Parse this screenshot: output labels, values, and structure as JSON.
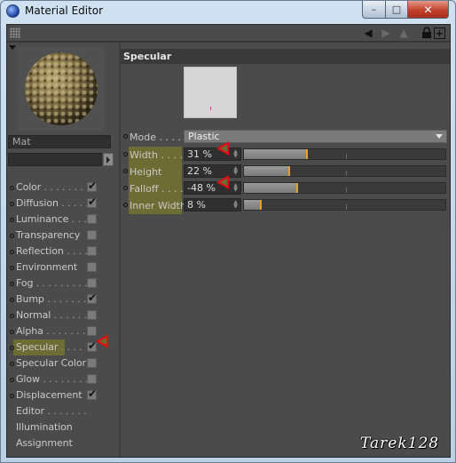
{
  "window": {
    "title": "Material Editor",
    "buttons": {
      "minimize": "–",
      "maximize": "□",
      "close": "✕"
    }
  },
  "toolbar": {
    "icons": [
      "grip-icon",
      "arrow-left-icon",
      "arrow-right-icon",
      "arrow-up-icon",
      "lock-icon",
      "new-icon"
    ],
    "glyphs": {
      "left": "◀",
      "right": "▶",
      "up": "▲",
      "lock": "🔒",
      "new": "+"
    }
  },
  "material": {
    "name": "Mat",
    "channels": [
      {
        "label": "Color",
        "dots": " . . . . . . . .",
        "checked": true,
        "has_checkbox": true
      },
      {
        "label": "Diffusion",
        "dots": " . . . . .",
        "checked": true,
        "has_checkbox": true
      },
      {
        "label": "Luminance",
        "dots": " . . .",
        "checked": false,
        "has_checkbox": true
      },
      {
        "label": "Transparency",
        "dots": "",
        "checked": false,
        "has_checkbox": true
      },
      {
        "label": "Reflection",
        "dots": " . . . .",
        "checked": false,
        "has_checkbox": true
      },
      {
        "label": "Environment",
        "dots": "",
        "checked": false,
        "has_checkbox": true
      },
      {
        "label": "Fog",
        "dots": " . . . . . . . . .",
        "checked": false,
        "has_checkbox": true
      },
      {
        "label": "Bump",
        "dots": " . . . . . . . .",
        "checked": true,
        "has_checkbox": true
      },
      {
        "label": "Normal",
        "dots": " . . . . . . .",
        "checked": false,
        "has_checkbox": true
      },
      {
        "label": "Alpha",
        "dots": " . . . . . . . .",
        "checked": false,
        "has_checkbox": true
      },
      {
        "label": "Specular",
        "dots": " . . . .",
        "checked": true,
        "has_checkbox": true,
        "active": true
      },
      {
        "label": "Specular Color",
        "dots": "",
        "checked": false,
        "has_checkbox": true
      },
      {
        "label": "Glow",
        "dots": " . . . . . . . . .",
        "checked": false,
        "has_checkbox": true
      },
      {
        "label": "Displacement",
        "dots": "",
        "checked": true,
        "has_checkbox": true
      },
      {
        "label": "Editor",
        "dots": " . . . . . . .",
        "checked": false,
        "has_checkbox": false
      },
      {
        "label": "Illumination",
        "dots": "",
        "checked": false,
        "has_checkbox": false
      },
      {
        "label": "Assignment",
        "dots": "",
        "checked": false,
        "has_checkbox": false
      }
    ]
  },
  "specular": {
    "section_title": "Specular",
    "mode": {
      "label": "Mode",
      "dots": " . . . .",
      "value": "Plastic"
    },
    "params": [
      {
        "label": "Width",
        "dots": " . . . .",
        "value": "31 %",
        "fraction": 0.31,
        "highlight": true,
        "arrow": true
      },
      {
        "label": "Height",
        "dots": "",
        "value": "22 %",
        "fraction": 0.22,
        "highlight": true,
        "arrow": false
      },
      {
        "label": "Falloff",
        "dots": " . . . .",
        "value": "-48 %",
        "fraction": 0.26,
        "highlight": true,
        "arrow": true
      },
      {
        "label": "Inner Width",
        "dots": "",
        "value": "8 %",
        "fraction": 0.08,
        "highlight": true,
        "arrow": false
      }
    ]
  },
  "colors": {
    "panel": "#4b4b4b",
    "highlight": "#6d6c34",
    "knob": "#e8a020",
    "annotation_arrow": "#e01010"
  },
  "signature": "Tarek128"
}
